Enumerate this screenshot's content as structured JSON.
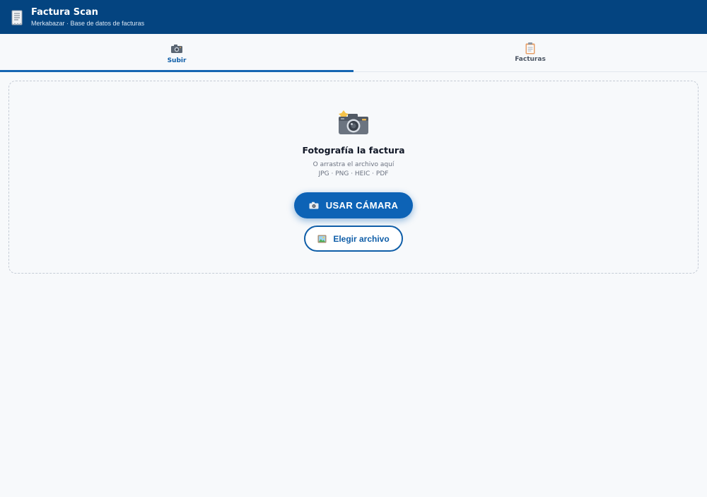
{
  "header": {
    "title": "Factura Scan",
    "subtitle": "Merkabazar · Base de datos de facturas",
    "logo_icon": "receipt-icon",
    "background": "#044480"
  },
  "tabs": [
    {
      "label": "Subir",
      "icon": "camera-icon",
      "active": true
    },
    {
      "label": "Facturas",
      "icon": "clipboard-icon",
      "active": false
    }
  ],
  "upload": {
    "icon": "camera-flash-icon",
    "title": "Fotografía la factura",
    "hint": "O arrastra el archivo aquí",
    "formats": "JPG · PNG · HEIC · PDF",
    "camera_button": {
      "label": "USAR CÁMARA",
      "icon": "camera-icon"
    },
    "file_button": {
      "label": "Elegir archivo",
      "icon": "picture-icon"
    }
  },
  "colors": {
    "accent": "#0d63b6",
    "page_background": "#f7f9fb",
    "dropzone_border": "#c5ccd6"
  }
}
